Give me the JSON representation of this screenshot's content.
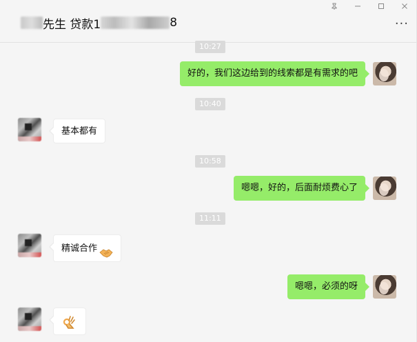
{
  "header": {
    "title_mid": "先生 贷款1",
    "title_end": "8",
    "more_label": "···"
  },
  "window_controls": {
    "pin_icon": "pin-icon",
    "minimize_icon": "minimize-icon",
    "maximize_icon": "maximize-icon",
    "close_icon": "close-icon"
  },
  "messages": [
    {
      "type": "time",
      "text": "10:27"
    },
    {
      "type": "sent",
      "text": "好的，我们这边给到的线索都是有需求的吧"
    },
    {
      "type": "time",
      "text": "10:40"
    },
    {
      "type": "received",
      "text": "基本都有"
    },
    {
      "type": "time",
      "text": "10:58"
    },
    {
      "type": "sent",
      "text": "嗯嗯，好的，后面耐烦费心了"
    },
    {
      "type": "time",
      "text": "11:11"
    },
    {
      "type": "received",
      "text": "精诚合作",
      "emoji": "handshake-icon"
    },
    {
      "type": "sent",
      "text": "嗯嗯，必须的呀"
    },
    {
      "type": "received",
      "text": "",
      "emoji": "ok-hand-icon"
    }
  ],
  "colors": {
    "sent_bubble": "#95ec69",
    "received_bubble": "#ffffff",
    "background": "#f5f5f5",
    "time_badge": "#dadada"
  }
}
